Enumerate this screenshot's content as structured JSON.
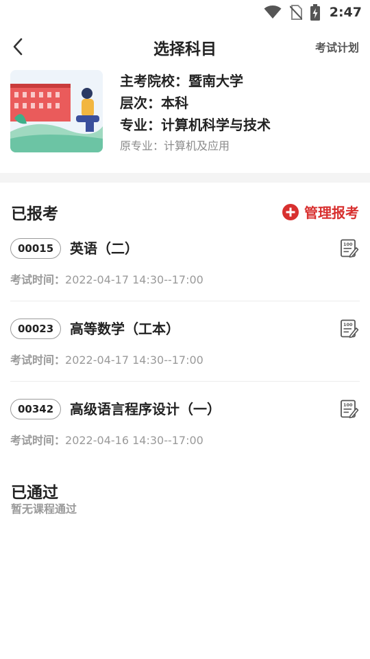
{
  "status_bar": {
    "time": "2:47",
    "icons": [
      "wifi-icon",
      "no-sim-icon",
      "battery-charging-icon"
    ]
  },
  "header": {
    "title": "选择科目",
    "back_icon": "chevron-left-icon",
    "plan_link": "考试计划"
  },
  "profile": {
    "school": "主考院校：暨南大学",
    "level": "层次：本科",
    "major": "专业：计算机科学与技术",
    "original_major": "原专业：计算机及应用"
  },
  "registered": {
    "title": "已报考",
    "manage_label": "管理报考",
    "manage_icon": "plus-circle-icon",
    "time_label": "考试时间：",
    "courses": [
      {
        "code": "00015",
        "name": "英语（二）",
        "time": "2022-04-17 14:30--17:00",
        "icon": "exam-score-edit-icon"
      },
      {
        "code": "00023",
        "name": "高等数学（工本）",
        "time": "2022-04-17 14:30--17:00",
        "icon": "exam-score-edit-icon"
      },
      {
        "code": "00342",
        "name": "高级语言程序设计（一）",
        "time": "2022-04-16 14:30--17:00",
        "icon": "exam-score-edit-icon"
      }
    ]
  },
  "passed": {
    "title": "已通过",
    "empty_text": "暂无课程通过"
  },
  "colors": {
    "accent": "#d8302f",
    "text": "#222222",
    "muted": "#9a9a9a",
    "divider": "#f4f4f4"
  }
}
